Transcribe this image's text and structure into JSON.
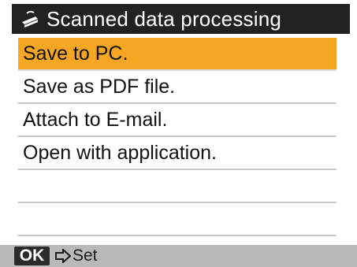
{
  "header": {
    "title": "Scanned data processing",
    "icon": "scanner-icon"
  },
  "menu": {
    "items": [
      {
        "label": "Save to PC.",
        "selected": true
      },
      {
        "label": "Save as PDF file.",
        "selected": false
      },
      {
        "label": "Attach to E-mail.",
        "selected": false
      },
      {
        "label": "Open with application.",
        "selected": false
      },
      {
        "label": "",
        "selected": false
      },
      {
        "label": "",
        "selected": false
      }
    ]
  },
  "footer": {
    "ok_label": "OK",
    "arrow_icon": "arrow-right-icon",
    "action_label": "Set"
  },
  "colors": {
    "title_bar": "#222222",
    "highlight": "#f5a623",
    "footer_bar": "#b9b9b9"
  }
}
